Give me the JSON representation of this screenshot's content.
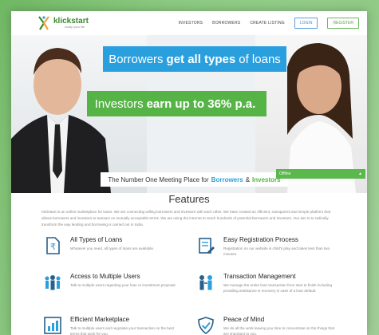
{
  "nav": {
    "logo_name": "klickstart",
    "logo_tag": "ready your life",
    "links": [
      "INVESTORS",
      "BORROWERS",
      "CREATE LISTING"
    ],
    "login": "LOGIN",
    "register": "REGISTER"
  },
  "hero": {
    "banner1_pre": "Borrowers",
    "banner1_bold": "get all types",
    "banner1_post": "of loans",
    "banner2_pre": "Investors",
    "banner2_bold": "earn up to 36% p.a.",
    "tagline_pre": "The Number One Meeting Place for",
    "tagline_b": "Borrowers",
    "tagline_amp": "&",
    "tagline_g": "Investors",
    "offline": "Offline"
  },
  "features": {
    "title": "Features",
    "intro": "Klickstart is an online marketplace for loans. We are connecting willing borrowers and investors with each other. We have created an efficient, transparent and simple platform that allows borrowers and investors to transact on mutually acceptable terms. We are using the internet to reach hundreds of potential borrowers and investors. Our aim is to radically transform the way lending and borrowing is carried out in India.",
    "items": [
      {
        "title": "All Types of Loans",
        "desc": "Whatever you need, all types of loans are available.",
        "icon": "rupee-document-icon"
      },
      {
        "title": "Easy Registration Process",
        "desc": "Registration on our website is child's play and takes less than two minutes.",
        "icon": "registration-icon"
      },
      {
        "title": "Access to Multiple Users",
        "desc": "Talk to multiple users regarding your loan or investment proposal.",
        "icon": "users-icon"
      },
      {
        "title": "Transaction Management",
        "desc": "We manage the entire loan transaction from start to finish including providing assistance in recovery in case of a loan default.",
        "icon": "transaction-icon"
      },
      {
        "title": "Efficient Marketplace",
        "desc": "Talk to multiple users and negotiate your transaction on the best terms that work for you.",
        "icon": "chart-icon"
      },
      {
        "title": "Peace of Mind",
        "desc": "We do all the work leaving you time to concentrate on the things that are important to you.",
        "icon": "shield-check-icon"
      }
    ]
  }
}
